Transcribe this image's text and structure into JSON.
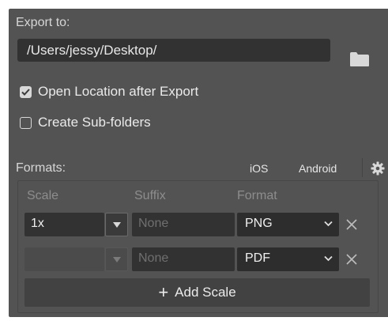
{
  "export": {
    "label": "Export to:",
    "path_value": "/Users/jessy/Desktop/",
    "folder_icon": "folder-icon"
  },
  "options": {
    "open_location": {
      "label": "Open Location after Export",
      "checked": true
    },
    "create_subfolders": {
      "label": "Create Sub-folders",
      "checked": false
    }
  },
  "formats": {
    "label": "Formats:",
    "presets": [
      "iOS",
      "Android"
    ],
    "settings_icon": "gear-icon",
    "columns": {
      "scale": "Scale",
      "suffix": "Suffix",
      "format": "Format"
    },
    "rows": [
      {
        "scale": "1x",
        "suffix_placeholder": "None",
        "format": "PNG",
        "scale_enabled": true
      },
      {
        "scale": "",
        "suffix_placeholder": "None",
        "format": "PDF",
        "scale_enabled": false
      }
    ],
    "add_scale_label": "Add Scale"
  },
  "colors": {
    "panel": "#535353",
    "field": "#323232",
    "text": "#e4e4e4"
  }
}
